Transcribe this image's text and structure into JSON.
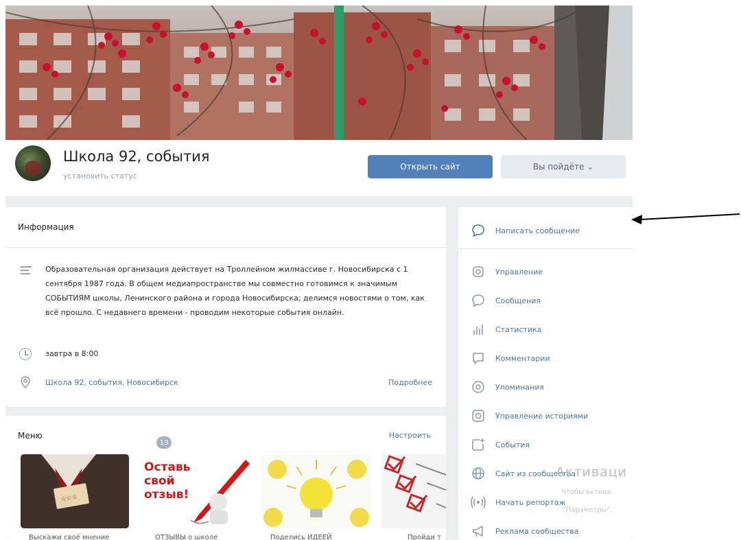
{
  "group": {
    "name": "Школа 92, события",
    "status_link": "установить статус"
  },
  "buttons": {
    "open_site": "Открыть сайт",
    "going": "Вы пойдёте ⌄"
  },
  "info": {
    "title": "Информация",
    "description": "Образовательная организация действует на Троллейном жилмассиве г. Новосибирска с 1 сентября 1987 года. В общем медиапространстве мы совместно готовимся к значимым СОБЫТИЯМ школы, Ленинского района и города Новосибирска; делимся новостями о том, как всё прошло. С недавнего времени - проводим некоторые события онлайн.",
    "time": "завтра в 8:00",
    "location": "Школа 92, события, Новосибирск",
    "more": "Подробнее"
  },
  "menu": {
    "title": "Меню",
    "setup": "Настроить",
    "items": [
      {
        "label": "Выскажи своё мнение"
      },
      {
        "label": "ОТЗЫВЫ о школе"
      },
      {
        "label": "Поделись ИДЕЕЙ"
      },
      {
        "label": "Пройди т"
      }
    ],
    "poster_text": [
      "Оставь",
      "свой",
      "отзыв!"
    ]
  },
  "sidebar": {
    "write_message": "Написать сообщение",
    "items": [
      {
        "label": "Управление",
        "icon": "gear-icon"
      },
      {
        "label": "Сообщения",
        "icon": "speech-bubble-icon"
      },
      {
        "label": "Статистика",
        "icon": "bar-chart-icon"
      },
      {
        "label": "Комментарии",
        "icon": "comment-icon"
      },
      {
        "label": "Упоминания",
        "icon": "at-icon"
      },
      {
        "label": "Управление историями",
        "icon": "stories-icon"
      },
      {
        "label": "События",
        "icon": "calendar-plus-icon"
      },
      {
        "label": "Сайт из сообщества",
        "icon": "globe-icon"
      },
      {
        "label": "Начать репортаж",
        "icon": "broadcast-icon"
      },
      {
        "label": "Реклама сообщества",
        "icon": "megaphone-icon"
      }
    ],
    "events_badge": "13"
  },
  "watermark": {
    "line1": "Активаци",
    "line2": "Чтобы актива",
    "line3": "\"Параметры\"."
  },
  "colors": {
    "accent": "#5181b8",
    "link": "#4a76a8",
    "background": "#edeef0"
  }
}
